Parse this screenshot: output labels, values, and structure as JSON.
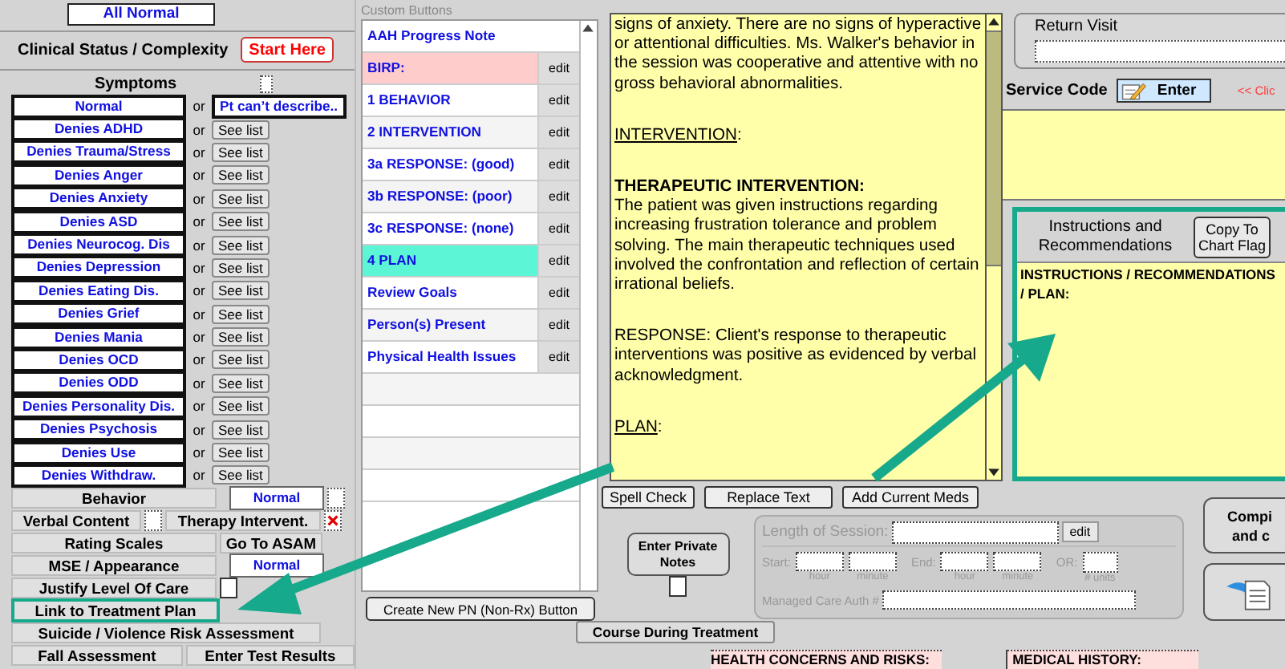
{
  "all_normal": "All Normal",
  "clinical_status": {
    "label": "Clinical Status / Complexity",
    "button": "Start Here"
  },
  "symptoms": {
    "title": "Symptoms",
    "checked": false,
    "rows": [
      {
        "label": "Normal",
        "or": "or",
        "alt": "Pt can’t describe..",
        "kind": "field"
      },
      {
        "label": "Denies ADHD",
        "or": "or",
        "alt": "See list",
        "kind": "button"
      },
      {
        "label": "Denies Trauma/Stress",
        "or": "or",
        "alt": "See list",
        "kind": "button"
      },
      {
        "label": "Denies Anger",
        "or": "or",
        "alt": "See list",
        "kind": "button"
      },
      {
        "label": "Denies Anxiety",
        "or": "or",
        "alt": "See list",
        "kind": "button"
      },
      {
        "label": "Denies ASD",
        "or": "or",
        "alt": "See list",
        "kind": "button"
      },
      {
        "label": "Denies Neurocog. Dis",
        "or": "or",
        "alt": "See list",
        "kind": "button"
      },
      {
        "label": "Denies Depression",
        "or": "or",
        "alt": "See list",
        "kind": "button"
      },
      {
        "label": "Denies Eating Dis.",
        "or": "or",
        "alt": "See list",
        "kind": "button"
      },
      {
        "label": "Denies Grief",
        "or": "or",
        "alt": "See list",
        "kind": "button"
      },
      {
        "label": "Denies Mania",
        "or": "or",
        "alt": "See list",
        "kind": "button"
      },
      {
        "label": "Denies OCD",
        "or": "or",
        "alt": "See list",
        "kind": "button"
      },
      {
        "label": "Denies ODD",
        "or": "or",
        "alt": "See list",
        "kind": "button"
      },
      {
        "label": "Denies Personality Dis.",
        "or": "or",
        "alt": "See list",
        "kind": "button"
      },
      {
        "label": "Denies Psychosis",
        "or": "or",
        "alt": "See list",
        "kind": "button"
      },
      {
        "label": "Denies Use",
        "or": "or",
        "alt": "See list",
        "kind": "button"
      },
      {
        "label": "Denies Withdraw.",
        "or": "or",
        "alt": "See list",
        "kind": "button"
      }
    ]
  },
  "assessment": {
    "behavior": {
      "label": "Behavior",
      "value": "Normal",
      "checked": false
    },
    "verbal_content": {
      "label": "Verbal Content",
      "checked": false
    },
    "therapy": {
      "label": "Therapy Intervent.",
      "flagged": true
    },
    "rating_scales": "Rating Scales",
    "asam": "Go To ASAM",
    "mse": {
      "label": "MSE / Appearance",
      "value": "Normal"
    },
    "justify": {
      "label": "Justify Level Of Care",
      "checked": false
    },
    "link": {
      "label": "Link to Treatment Plan",
      "highlighted": true
    },
    "suicide": "Suicide / Violence Risk Assessment",
    "fall": "Fall Assessment",
    "test": "Enter Test Results"
  },
  "custom_buttons": {
    "title": "Custom Buttons",
    "items": [
      {
        "label": "AAH Progress Note",
        "color": "#ffffff"
      },
      {
        "label": "BIRP:",
        "edit": "edit",
        "color": "#ffcccc"
      },
      {
        "label": "1 BEHAVIOR",
        "edit": "edit",
        "color": "#ffffff"
      },
      {
        "label": "2 INTERVENTION",
        "edit": "edit",
        "color": "#f4f4f4"
      },
      {
        "label": "3a RESPONSE: (good)",
        "edit": "edit",
        "color": "#ffffff"
      },
      {
        "label": "3b RESPONSE: (poor)",
        "edit": "edit",
        "color": "#f4f4f4"
      },
      {
        "label": "3c RESPONSE: (none)",
        "edit": "edit",
        "color": "#ffffff"
      },
      {
        "label": "4 PLAN",
        "edit": "edit",
        "color": "#5cf5d6"
      },
      {
        "label": "Review Goals",
        "edit": "edit",
        "color": "#ffffff"
      },
      {
        "label": "Person(s) Present",
        "edit": "edit",
        "color": "#f4f4f4"
      },
      {
        "label": "Physical Health Issues",
        "edit": "edit",
        "color": "#ffffff"
      }
    ],
    "create": "Create New PN (Non-Rx) Button"
  },
  "note": {
    "paragraphs": [
      {
        "kind": "text",
        "text": "signs of anxiety. There are no signs of hyperactive or attentional difficulties. Ms. Walker's behavior in the session was cooperative and attentive with no gross behavioral abnormalities."
      },
      {
        "kind": "underlined",
        "text": "INTERVENTION",
        "suffix": ":"
      },
      {
        "kind": "text",
        "text": "**THERAPEUTIC INTERVENTION:**\nThe patient was given instructions regarding increasing frustration tolerance and problem solving. The main therapeutic techniques used involved the confrontation and reflection of certain irrational beliefs."
      },
      {
        "kind": "text",
        "text": "RESPONSE: Client's response to therapeutic interventions was positive as evidenced by verbal acknowledgment."
      },
      {
        "kind": "underlined",
        "text": "PLAN",
        "suffix": ":"
      }
    ]
  },
  "note_buttons": [
    "Spell Check",
    "Replace Text",
    "Add Current Meds"
  ],
  "private_notes": {
    "label": "Enter Private Notes",
    "checked": false
  },
  "session": {
    "length_label": "Length of Session:",
    "edit": "edit",
    "start": "Start:",
    "start_hour": "hour",
    "start_minute": "minute",
    "end": "End:",
    "end_hour": "hour",
    "end_minute": "minute",
    "or": "OR:",
    "units": "# units",
    "auth": "Managed Care Auth #"
  },
  "course": "Course During Treatment",
  "bottom": {
    "health": "HEALTH CONCERNS AND RISKS:",
    "medical": "MEDICAL HISTORY:"
  },
  "return_visit": {
    "label": "Return Visit"
  },
  "service_code": {
    "label": "Service Code",
    "button": "Enter",
    "hint": "<< Clic"
  },
  "instructions": {
    "title": "Instructions and Recommendations",
    "button": "Copy To Chart Flag",
    "text": "INSTRUCTIONS / RECOMMENDATIONS / PLAN:",
    "highlighted": true
  },
  "compile": {
    "lines": [
      "Compi",
      "and c"
    ]
  }
}
